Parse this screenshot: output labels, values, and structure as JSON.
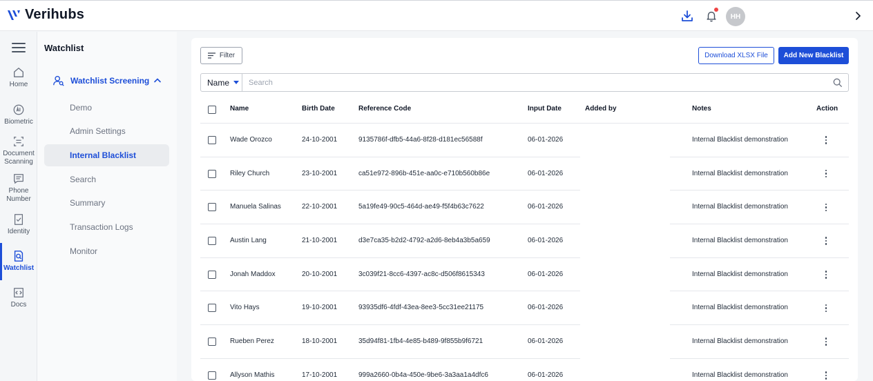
{
  "brand": {
    "name": "Verihubs"
  },
  "header": {
    "avatar_initials": "HH"
  },
  "rail": {
    "items": [
      {
        "key": "home",
        "label": "Home",
        "icon": "home-icon"
      },
      {
        "key": "biometric",
        "label": "Biometric",
        "icon": "biometric-icon"
      },
      {
        "key": "document",
        "label_line1": "Document",
        "label_line2": "Scanning",
        "icon": "document-scan-icon"
      },
      {
        "key": "phone",
        "label_line1": "Phone",
        "label_line2": "Number",
        "icon": "message-icon"
      },
      {
        "key": "identity",
        "label": "Identity",
        "icon": "identity-check-icon"
      },
      {
        "key": "watchlist",
        "label": "Watchlist",
        "icon": "watchlist-icon"
      },
      {
        "key": "docs",
        "label": "Docs",
        "icon": "code-doc-icon"
      }
    ]
  },
  "subnav": {
    "title": "Watchlist",
    "group": "Watchlist Screening",
    "items": [
      "Demo",
      "Admin Settings",
      "Internal Blacklist",
      "Search",
      "Summary",
      "Transaction Logs",
      "Monitor"
    ],
    "active": "Internal Blacklist"
  },
  "toolbar": {
    "filter_label": "Filter",
    "download_label": "Download XLSX File",
    "add_label": "Add New Blacklist"
  },
  "search": {
    "field": "Name",
    "placeholder": "Search"
  },
  "table": {
    "columns": {
      "name": "Name",
      "birth": "Birth Date",
      "ref": "Reference Code",
      "input": "Input Date",
      "added": "Added by",
      "notes": "Notes",
      "action": "Action"
    },
    "rows": [
      {
        "name": "Wade Orozco",
        "birth": "24-10-2001",
        "ref": "9135786f-dfb5-44a6-8f28-d181ec56588f",
        "input": "06-01-2026",
        "added": "",
        "notes": "Internal Blacklist demonstration"
      },
      {
        "name": "Riley Church",
        "birth": "23-10-2001",
        "ref": "ca51e972-896b-451e-aa0c-e710b560b86e",
        "input": "06-01-2026",
        "added": "",
        "notes": "Internal Blacklist demonstration"
      },
      {
        "name": "Manuela Salinas",
        "birth": "22-10-2001",
        "ref": "5a19fe49-90c5-464d-ae49-f5f4b63c7622",
        "input": "06-01-2026",
        "added": "",
        "notes": "Internal Blacklist demonstration"
      },
      {
        "name": "Austin Lang",
        "birth": "21-10-2001",
        "ref": "d3e7ca35-b2d2-4792-a2d6-8eb4a3b5a659",
        "input": "06-01-2026",
        "added": "",
        "notes": "Internal Blacklist demonstration"
      },
      {
        "name": "Jonah Maddox",
        "birth": "20-10-2001",
        "ref": "3c039f21-8cc6-4397-ac8c-d506f8615343",
        "input": "06-01-2026",
        "added": "",
        "notes": "Internal Blacklist demonstration"
      },
      {
        "name": "Vito Hays",
        "birth": "19-10-2001",
        "ref": "93935df6-4fdf-43ea-8ee3-5cc31ee21175",
        "input": "06-01-2026",
        "added": "",
        "notes": "Internal Blacklist demonstration"
      },
      {
        "name": "Rueben Perez",
        "birth": "18-10-2001",
        "ref": "35d94f81-1fb4-4e85-b489-9f855b9f6721",
        "input": "06-01-2026",
        "added": "",
        "notes": "Internal Blacklist demonstration"
      },
      {
        "name": "Allyson Mathis",
        "birth": "17-10-2001",
        "ref": "999a2660-0b4a-450e-9be6-3a3aa1a4dfc6",
        "input": "06-01-2026",
        "added": "",
        "notes": "Internal Blacklist demonstration"
      }
    ]
  },
  "colors": {
    "accent": "#1d4ed8",
    "notification": "#ef4444"
  }
}
